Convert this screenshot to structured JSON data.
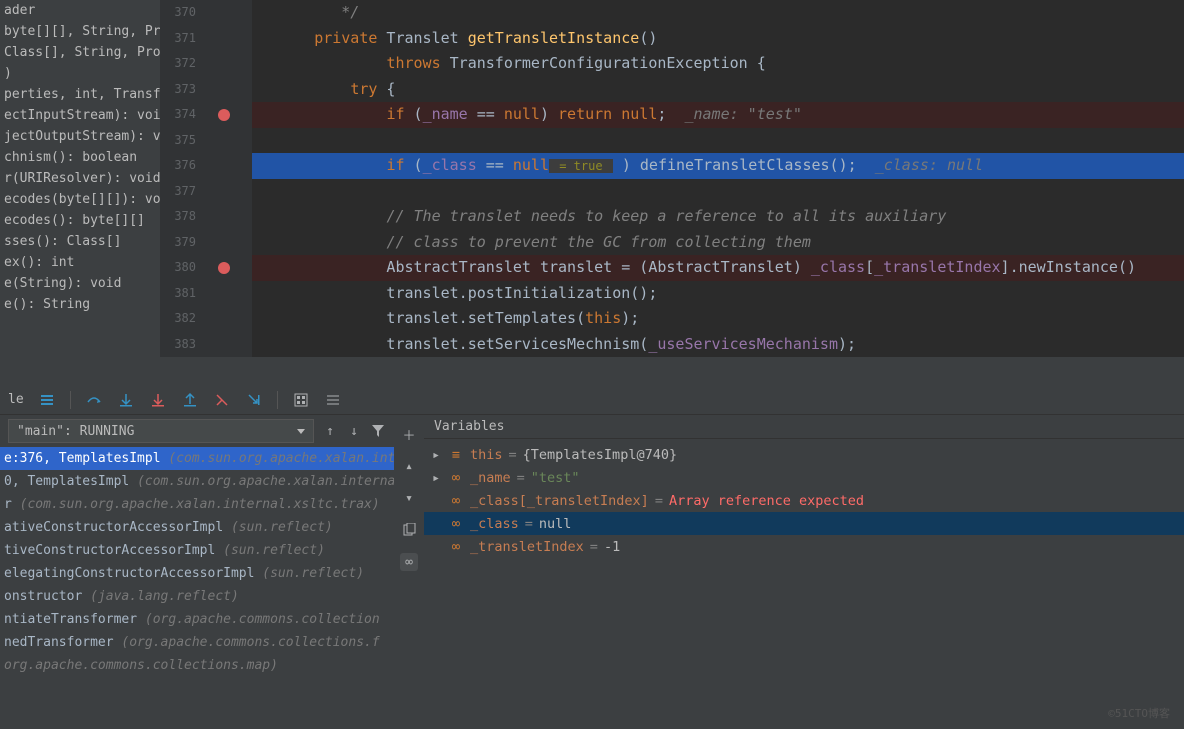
{
  "structure_items": [
    "ader",
    "byte[][], String, Prope",
    "Class[], String, Prope",
    ")",
    "perties, int, Transform",
    "ectInputStream): void",
    "jectOutputStream): v",
    "chnism(): boolean",
    "r(URIResolver): void",
    "ecodes(byte[][]): void",
    "ecodes(): byte[][]",
    "sses(): Class[]",
    "ex(): int",
    "e(String): void",
    "e(): String"
  ],
  "lines": [
    370,
    371,
    372,
    373,
    374,
    375,
    376,
    377,
    378,
    379,
    380,
    381,
    382,
    383
  ],
  "breakpoints": [
    374,
    380
  ],
  "debug_line": 376,
  "code": {
    "l370": {
      "indent": "         ",
      "text": "*/"
    },
    "l371": {
      "kw1": "private",
      "type": " Translet ",
      "method": "getTransletInstance",
      "tail": "()"
    },
    "l372": {
      "kw1": "throws",
      "tail": " TransformerConfigurationException {"
    },
    "l373": {
      "kw1": "try",
      "tail": " {"
    },
    "l374": {
      "kw1": "if",
      "p1": " (",
      "f1": "_name",
      "p2": " == ",
      "kw2": "null",
      "p3": ") ",
      "kw3": "return null",
      "p4": ";  ",
      "hint": "_name: \"test\""
    },
    "l376": {
      "kw1": "if",
      "p1": " (",
      "f1": "_class",
      "p2": " == ",
      "kw2": "null",
      "inline": " = true ",
      "p3": " ) defineTransletClasses();  ",
      "hint": "_class: null"
    },
    "l378": {
      "c": "// The translet needs to keep a reference to all its auxiliary"
    },
    "l379": {
      "c": "// class to prevent the GC from collecting them"
    },
    "l380": {
      "p1": "AbstractTranslet translet = (AbstractTranslet) ",
      "f1": "_class",
      "p2": "[",
      "f2": "_transletIndex",
      "p3": "].newInstance()"
    },
    "l381": {
      "p1": "translet.postInitialization();"
    },
    "l382": {
      "p1": "translet.setTemplates(",
      "kw1": "this",
      "p2": ");"
    },
    "l383": {
      "p1": "translet.setServicesMechnism(",
      "f1": "_useServicesMechanism",
      "p2": ");"
    }
  },
  "toolbar_label": "le",
  "thread": "\"main\": RUNNING",
  "frames": [
    {
      "sel": true,
      "txt": "e:376, TemplatesImpl ",
      "gray": "(com.sun.org.apache.xalan.int"
    },
    {
      "txt": "0, TemplatesImpl ",
      "gray": "(com.sun.org.apache.xalan.interna"
    },
    {
      "txt": "r ",
      "gray": "(com.sun.org.apache.xalan.internal.xsltc.trax)"
    },
    {
      "txt": "ativeConstructorAccessorImpl ",
      "gray": "(sun.reflect)"
    },
    {
      "txt": "tiveConstructorAccessorImpl ",
      "gray": "(sun.reflect)"
    },
    {
      "txt": "elegatingConstructorAccessorImpl ",
      "gray": "(sun.reflect)"
    },
    {
      "txt": "onstructor ",
      "gray": "(java.lang.reflect)"
    },
    {
      "txt": "ntiateTransformer ",
      "gray": "(org.apache.commons.collection"
    },
    {
      "txt": "nedTransformer ",
      "gray": "(org.apache.commons.collections.f"
    },
    {
      "txt": "",
      "gray": "org.apache.commons.collections.map)"
    }
  ],
  "vars_header": "Variables",
  "vars": [
    {
      "expand": true,
      "icon": "obj",
      "name": "this",
      "eq": " = ",
      "val": "{TemplatesImpl@740}"
    },
    {
      "expand": true,
      "icon": "glasses",
      "name": "_name",
      "eq": " = ",
      "valtype": "str",
      "val": "\"test\""
    },
    {
      "expand": false,
      "icon": "glasses",
      "name": "_class[_transletIndex]",
      "eq": " = ",
      "valtype": "err",
      "val": "Array reference expected"
    },
    {
      "expand": false,
      "icon": "glasses",
      "sel": true,
      "name": "_class",
      "eq": " = ",
      "val": "null"
    },
    {
      "expand": false,
      "icon": "glasses",
      "name": "_transletIndex",
      "eq": " = ",
      "val": "-1"
    }
  ],
  "watermark": "©51CTO博客"
}
